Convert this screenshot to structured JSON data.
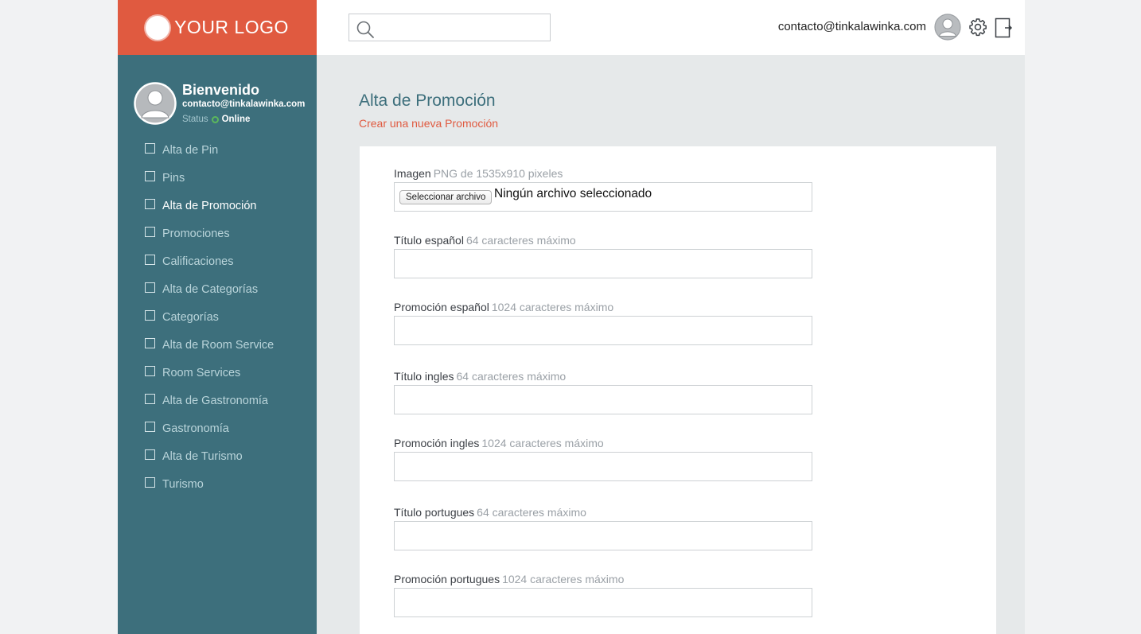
{
  "logo": {
    "text": "YOUR LOGO"
  },
  "header": {
    "search_placeholder": "",
    "user_email": "contacto@tinkalawinka.com"
  },
  "profile": {
    "welcome": "Bienvenido",
    "email": "contacto@tinkalawinka.com",
    "status_label": "Status",
    "status_value": "Online"
  },
  "sidebar": {
    "items": [
      {
        "label": "Alta de Pin"
      },
      {
        "label": "Pins"
      },
      {
        "label": "Alta de Promoción"
      },
      {
        "label": "Promociones"
      },
      {
        "label": "Calificaciones"
      },
      {
        "label": "Alta de Categorías"
      },
      {
        "label": "Categorías"
      },
      {
        "label": "Alta de Room Service"
      },
      {
        "label": "Room Services"
      },
      {
        "label": "Alta de Gastronomía"
      },
      {
        "label": "Gastronomía"
      },
      {
        "label": "Alta de Turismo"
      },
      {
        "label": "Turismo"
      }
    ],
    "active_index": 2
  },
  "main": {
    "title": "Alta de Promoción",
    "subtitle": "Crear una nueva Promoción",
    "image_field": {
      "label": "Imagen",
      "hint": "PNG de 1535x910 pixeles",
      "button_label": "Seleccionar archivo",
      "file_status": "Ningún archivo seleccionado"
    },
    "fields": [
      {
        "label": "Título español",
        "hint": "64 caracteres máximo",
        "value": ""
      },
      {
        "label": "Promoción español",
        "hint": "1024 caracteres máximo",
        "value": ""
      },
      {
        "label": "Título ingles",
        "hint": "64 caracteres máximo",
        "value": ""
      },
      {
        "label": "Promoción ingles",
        "hint": "1024 caracteres máximo",
        "value": ""
      },
      {
        "label": "Título portugues",
        "hint": "64 caracteres máximo",
        "value": ""
      },
      {
        "label": "Promoción portugues",
        "hint": "1024 caracteres máximo",
        "value": ""
      }
    ]
  },
  "colors": {
    "brand": "#e05a40",
    "sidebar": "#3d6f7c",
    "status_online": "#5cb85c"
  },
  "icons": {
    "search": "search-icon",
    "avatar": "avatar-icon",
    "settings": "gear-icon",
    "logout": "logout-icon",
    "menu_item": "checkbox-icon"
  }
}
